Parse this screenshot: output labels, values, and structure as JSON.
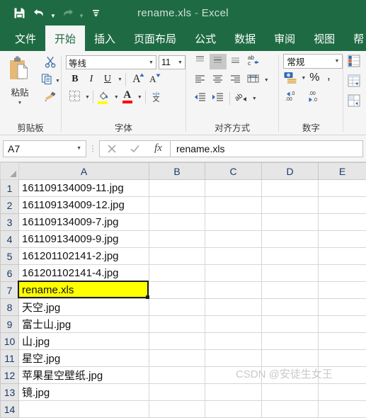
{
  "window": {
    "title_file": "rename.xls",
    "title_sep": "-",
    "title_app": "Excel",
    "qat": {
      "save": "save-icon",
      "undo": "undo-icon",
      "redo": "redo-icon",
      "customize": "customize-quick-access-icon"
    }
  },
  "ribbon": {
    "tabs": [
      {
        "label": "文件",
        "active": false
      },
      {
        "label": "开始",
        "active": true
      },
      {
        "label": "插入",
        "active": false
      },
      {
        "label": "页面布局",
        "active": false
      },
      {
        "label": "公式",
        "active": false
      },
      {
        "label": "数据",
        "active": false
      },
      {
        "label": "审阅",
        "active": false
      },
      {
        "label": "视图",
        "active": false
      },
      {
        "label": "帮",
        "active": false
      }
    ],
    "groups": {
      "clipboard": {
        "label": "剪贴板",
        "paste_label": "粘贴",
        "cut": "scissors-icon",
        "copy": "copy-icon",
        "format_painter": "format-painter-icon"
      },
      "font": {
        "label": "字体",
        "font_name": "等线",
        "font_size": "11",
        "bold": "B",
        "italic": "I",
        "underline": "U",
        "grow_font": "A",
        "shrink_font": "A",
        "borders": "borders-icon",
        "fill_color": "fill-color-icon",
        "fill_swatch": "#FFFF00",
        "font_color": "A",
        "font_color_swatch": "#FF0000",
        "phonetic": "phonetic-guide-icon"
      },
      "alignment": {
        "label": "对齐方式",
        "align_top": "align-top-icon",
        "align_middle": "align-middle-icon",
        "align_bottom": "align-bottom-icon",
        "wrap_text": "wrap-text-icon",
        "align_left": "align-left-icon",
        "align_center": "align-center-icon",
        "align_right": "align-right-icon",
        "merge_center": "merge-and-center-icon",
        "decrease_indent": "decrease-indent-icon",
        "increase_indent": "increase-indent-icon",
        "orientation": "text-orientation-icon"
      },
      "number": {
        "label": "数字",
        "format": "常规",
        "accounting": "accounting-format-icon",
        "percent": "%",
        "comma": ",",
        "increase_decimal_top": ".00",
        "increase_decimal_bottom": ".0",
        "decrease_decimal_top": ".0",
        "decrease_decimal_bottom": ".00"
      },
      "styles": {
        "conditional_formatting": "conditional-formatting-icon",
        "format_as_table": "format-as-table-icon",
        "cell_styles": "cell-styles-icon"
      }
    }
  },
  "formula_bar": {
    "name_box": "A7",
    "cancel": "cancel-icon",
    "enter": "confirm-icon",
    "insert_function": "fx",
    "value": "rename.xls"
  },
  "sheet": {
    "columns": [
      "A",
      "B",
      "C",
      "D",
      "E"
    ],
    "rows": [
      {
        "num": "1",
        "a": "161109134009-11.jpg"
      },
      {
        "num": "2",
        "a": "161109134009-12.jpg"
      },
      {
        "num": "3",
        "a": "161109134009-7.jpg"
      },
      {
        "num": "4",
        "a": "161109134009-9.jpg"
      },
      {
        "num": "5",
        "a": "161201102141-2.jpg"
      },
      {
        "num": "6",
        "a": "161201102141-4.jpg"
      },
      {
        "num": "7",
        "a": "rename.xls"
      },
      {
        "num": "8",
        "a": "天空.jpg"
      },
      {
        "num": "9",
        "a": "富士山.jpg"
      },
      {
        "num": "10",
        "a": "山.jpg"
      },
      {
        "num": "11",
        "a": "星空.jpg"
      },
      {
        "num": "12",
        "a": "苹果星空壁纸.jpg"
      },
      {
        "num": "13",
        "a": "镜.jpg"
      },
      {
        "num": "14",
        "a": ""
      }
    ],
    "selected_row_index": 6,
    "highlight_color": "#FFFF00",
    "watermark": "CSDN @安徒生女王"
  }
}
